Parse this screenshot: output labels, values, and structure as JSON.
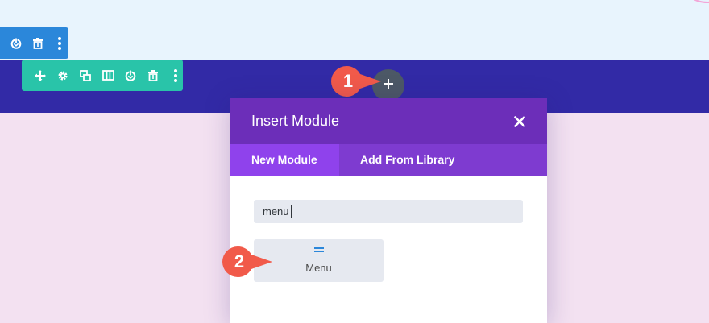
{
  "section_toolbar": {
    "icons": [
      "power-icon",
      "trash-icon",
      "more-vertical-icon"
    ],
    "color": "#2b87da"
  },
  "row_toolbar": {
    "icons": [
      "move-icon",
      "gear-icon",
      "duplicate-icon",
      "columns-icon",
      "power-icon",
      "trash-icon",
      "more-vertical-icon"
    ],
    "color": "#29c4a9"
  },
  "add_module_button": {
    "icon": "plus-icon",
    "color": "#4c5866"
  },
  "callouts": [
    {
      "number": "1",
      "color": "#f15a4a"
    },
    {
      "number": "2",
      "color": "#f15a4a"
    }
  ],
  "modal": {
    "title": "Insert Module",
    "close_icon": "close-icon",
    "header_color": "#6c2eb9",
    "tabs": [
      {
        "label": "New Module",
        "active": true
      },
      {
        "label": "Add From Library",
        "active": false
      }
    ],
    "search": {
      "value": "menu"
    },
    "results": [
      {
        "label": "Menu",
        "icon": "menu-icon"
      }
    ]
  },
  "colors": {
    "top_band": "#e8f4fd",
    "dark_band": "#322aa6",
    "page_background": "#f3e1f1"
  }
}
